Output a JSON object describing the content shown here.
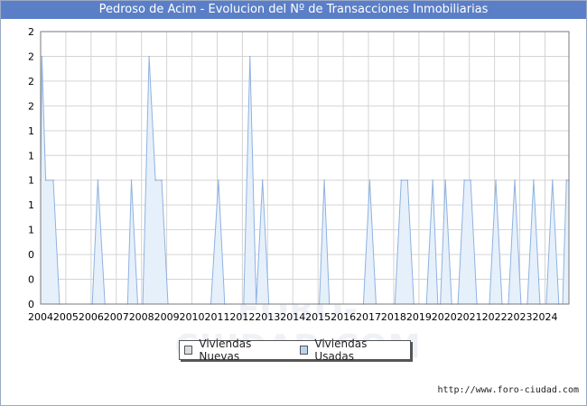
{
  "chart_data": {
    "type": "area",
    "title": "Pedroso de Acim - Evolucion del Nº de Transacciones Inmobiliarias",
    "x_tick_labels": [
      "2004",
      "2005",
      "2006",
      "2007",
      "2008",
      "2009",
      "2010",
      "2011",
      "2012",
      "2013",
      "2014",
      "2015",
      "2016",
      "2017",
      "2018",
      "2019",
      "2020",
      "2021",
      "2022",
      "2023",
      "2024"
    ],
    "y_tick_labels": [
      "0",
      "0",
      "0",
      "1",
      "1",
      "1",
      "1",
      "1",
      "2",
      "2",
      "2",
      "2"
    ],
    "ylim": [
      0,
      2.2
    ],
    "xlim": [
      2004.0,
      2024.95
    ],
    "grid": true,
    "legend_position": "bottom-center",
    "series": [
      {
        "name": "Viviendas Nuevas",
        "color": "#dddddd",
        "values": []
      },
      {
        "name": "Viviendas Usadas",
        "color": "#bcd3f0",
        "points": [
          [
            2004.0,
            1.0
          ],
          [
            2004.05,
            2.0
          ],
          [
            2004.2,
            1.0
          ],
          [
            2004.5,
            1.0
          ],
          [
            2004.75,
            0
          ],
          [
            2006.05,
            0
          ],
          [
            2006.27,
            1.0
          ],
          [
            2006.55,
            0
          ],
          [
            2007.45,
            0
          ],
          [
            2007.6,
            1.0
          ],
          [
            2007.85,
            0
          ],
          [
            2008.05,
            0
          ],
          [
            2008.3,
            2.0
          ],
          [
            2008.55,
            1.0
          ],
          [
            2008.8,
            1.0
          ],
          [
            2009.05,
            0
          ],
          [
            2010.75,
            0
          ],
          [
            2011.05,
            1.0
          ],
          [
            2011.3,
            0
          ],
          [
            2012.05,
            0
          ],
          [
            2012.3,
            2.0
          ],
          [
            2012.55,
            0
          ],
          [
            2012.8,
            1.0
          ],
          [
            2013.05,
            0
          ],
          [
            2015.05,
            0
          ],
          [
            2015.25,
            1.0
          ],
          [
            2015.45,
            0
          ],
          [
            2016.8,
            0
          ],
          [
            2017.05,
            1.0
          ],
          [
            2017.3,
            0
          ],
          [
            2018.05,
            0
          ],
          [
            2018.3,
            1.0
          ],
          [
            2018.55,
            1.0
          ],
          [
            2018.8,
            0
          ],
          [
            2019.3,
            0
          ],
          [
            2019.55,
            1.0
          ],
          [
            2019.75,
            0
          ],
          [
            2019.85,
            0
          ],
          [
            2020.05,
            1.0
          ],
          [
            2020.3,
            0
          ],
          [
            2020.55,
            0
          ],
          [
            2020.8,
            1.0
          ],
          [
            2021.05,
            1.0
          ],
          [
            2021.3,
            0
          ],
          [
            2021.8,
            0
          ],
          [
            2022.05,
            1.0
          ],
          [
            2022.3,
            0
          ],
          [
            2022.55,
            0
          ],
          [
            2022.8,
            1.0
          ],
          [
            2023.05,
            0
          ],
          [
            2023.3,
            0
          ],
          [
            2023.55,
            1.0
          ],
          [
            2023.8,
            0
          ],
          [
            2024.05,
            0
          ],
          [
            2024.3,
            1.0
          ],
          [
            2024.55,
            0
          ],
          [
            2024.7,
            0
          ],
          [
            2024.85,
            1.0
          ],
          [
            2024.95,
            1.0
          ]
        ]
      }
    ]
  },
  "footer_url": "http://www.foro-ciudad.com",
  "watermark": "FORO-CIUDAD.COM"
}
